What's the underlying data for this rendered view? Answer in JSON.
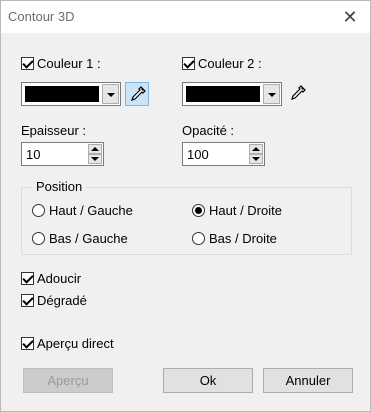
{
  "window": {
    "title": "Contour 3D",
    "close_glyph": "✕"
  },
  "color1": {
    "label": "Couleur 1 :",
    "checked": true,
    "value": "#000000"
  },
  "color2": {
    "label": "Couleur 2 :",
    "checked": true,
    "value": "#000000"
  },
  "thickness": {
    "label": "Epaisseur :",
    "value": "10"
  },
  "opacity": {
    "label": "Opacité :",
    "value": "100"
  },
  "position": {
    "legend": "Position",
    "options": [
      {
        "label": "Haut / Gauche",
        "selected": false
      },
      {
        "label": "Haut / Droite",
        "selected": true
      },
      {
        "label": "Bas / Gauche",
        "selected": false
      },
      {
        "label": "Bas / Droite",
        "selected": false
      }
    ]
  },
  "options": {
    "smooth": {
      "label": "Adoucir",
      "checked": true
    },
    "gradient": {
      "label": "Dégradé",
      "checked": true
    },
    "live_preview": {
      "label": "Aperçu direct",
      "checked": true
    }
  },
  "buttons": {
    "preview": "Aperçu",
    "ok": "Ok",
    "cancel": "Annuler"
  },
  "colors": {
    "accent_picker_bg": "#cce4f7",
    "swatch": "#000000"
  }
}
